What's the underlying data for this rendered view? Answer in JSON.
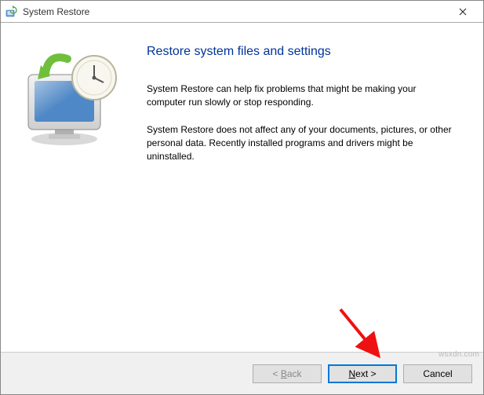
{
  "titlebar": {
    "title": "System Restore"
  },
  "content": {
    "heading": "Restore system files and settings",
    "paragraph1": "System Restore can help fix problems that might be making your computer run slowly or stop responding.",
    "paragraph2": "System Restore does not affect any of your documents, pictures, or other personal data. Recently installed programs and drivers might be uninstalled."
  },
  "footer": {
    "back_prefix": "< ",
    "back_letter": "B",
    "back_suffix": "ack",
    "next_letter": "N",
    "next_suffix": "ext >",
    "cancel": "Cancel"
  },
  "watermark": "wsxdn.com"
}
